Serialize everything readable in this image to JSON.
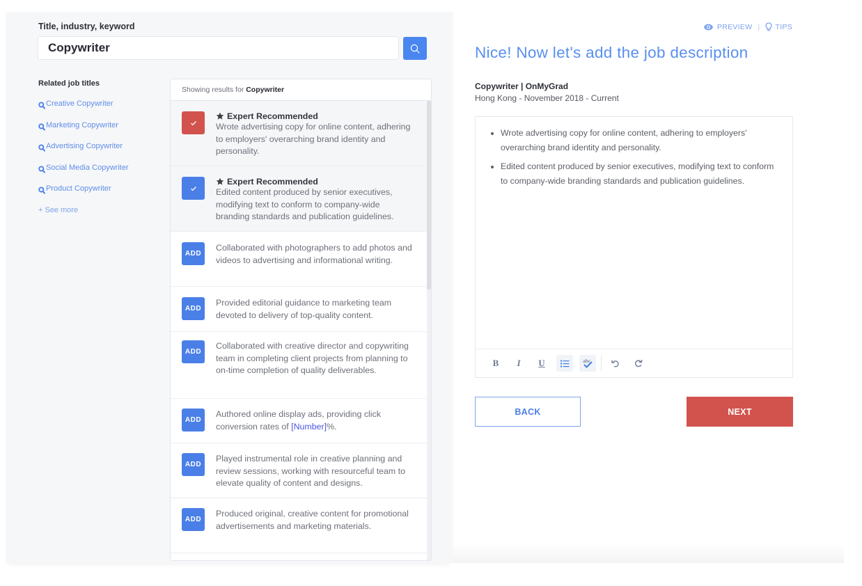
{
  "search": {
    "label": "Title, industry, keyword",
    "value": "Copywriter",
    "button_icon": "search-icon"
  },
  "related": {
    "title": "Related job titles",
    "items": [
      {
        "label": "Creative Copywriter",
        "icon": "search-icon"
      },
      {
        "label": "Marketing Copywriter",
        "icon": "search-icon"
      },
      {
        "label": "Advertising Copywriter",
        "icon": "search-icon"
      },
      {
        "label": "Social Media Copywriter",
        "icon": "search-icon"
      },
      {
        "label": "Product Copywriter",
        "icon": "search-icon"
      }
    ],
    "see_more": "+ See more"
  },
  "results": {
    "header_prefix": "Showing results for ",
    "header_term": "Copywriter",
    "items": [
      {
        "state": "selected",
        "button_color": "red",
        "badge": "Expert Recommended",
        "text": "Wrote advertising copy for online content, adhering to employers' overarching brand identity and personality."
      },
      {
        "state": "selected",
        "button_color": "blue",
        "badge": "Expert Recommended",
        "text": "Edited content produced by senior executives, modifying text to conform to company-wide branding standards and publication guidelines."
      },
      {
        "state": "add",
        "button_label": "ADD",
        "text": "Collaborated with photographers to add photos and videos to advertising and informational writing."
      },
      {
        "state": "add",
        "button_label": "ADD",
        "text": "Provided editorial guidance to marketing team devoted to delivery of top-quality content."
      },
      {
        "state": "add",
        "button_label": "ADD",
        "text": "Collaborated with creative director and copywriting team in completing client projects from planning to on-time completion of quality deliverables."
      },
      {
        "state": "add",
        "button_label": "ADD",
        "text_before": "Authored online display ads, providing click conversion rates of ",
        "token": "[Number]",
        "text_after": "%."
      },
      {
        "state": "add",
        "button_label": "ADD",
        "text": "Played instrumental role in creative planning and review sessions, working with resourceful team to elevate quality of content and designs."
      },
      {
        "state": "add",
        "button_label": "ADD",
        "text": "Produced original, creative content for promotional advertisements and marketing materials."
      }
    ]
  },
  "top_links": {
    "preview": "PREVIEW",
    "separator": "|",
    "tips": "TIPS"
  },
  "main": {
    "title": "Nice! Now let's add the job description",
    "job_title": "Copywriter | OnMyGrad",
    "job_meta": "Hong Kong - November 2018 - Current",
    "bullets": [
      "Wrote advertising copy for online content, adhering to employers' overarching brand identity and personality.",
      "Edited content produced by senior executives, modifying text to conform to company-wide branding standards and publication guidelines."
    ],
    "toolbar": [
      "bold",
      "italic",
      "underline",
      "bullet-list",
      "spellcheck",
      "undo",
      "redo"
    ],
    "back_label": "BACK",
    "next_label": "NEXT"
  },
  "colors": {
    "accent_blue": "#4a7fe8",
    "accent_red": "#d2534d",
    "title_blue": "#5a8ff0"
  }
}
